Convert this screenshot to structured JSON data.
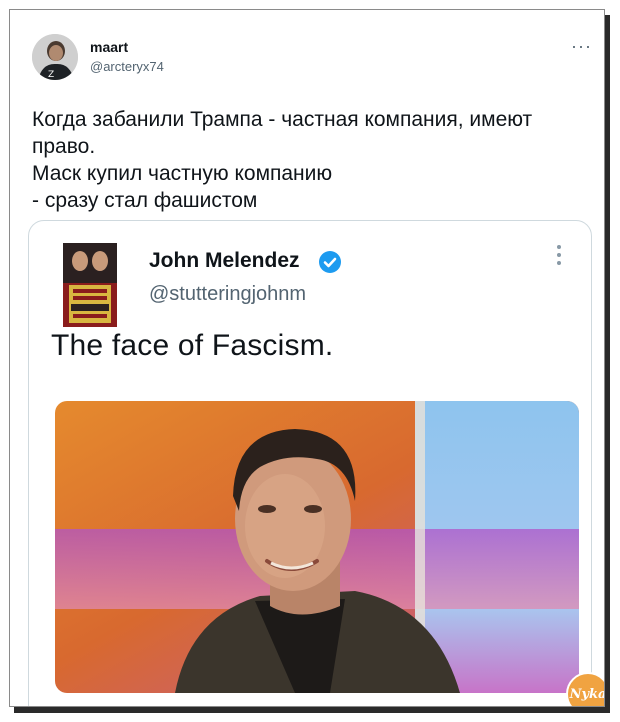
{
  "tweet": {
    "author_name": "maart",
    "author_handle": "@arcteryx74",
    "more_label": "···",
    "text_lines": [
      "Когда забанили Трампа - частная компания, имеют",
      "право.",
      "Маск купил частную компанию",
      "- сразу стал фашистом"
    ]
  },
  "quoted": {
    "author_name": "John Melendez",
    "author_handle": "@stutteringjohnm",
    "text": "The face of Fascism.",
    "avatar_book_text": "EASY FOR YOU TO SAY STUTTERING JOHN MELENDEZ",
    "verified": true,
    "image_subject": "photo-portrait"
  },
  "watermark": "Nyka",
  "colors": {
    "text": "#0f1419",
    "secondary": "#536471",
    "verified": "#1d9bf0",
    "border": "#cfd9de"
  }
}
